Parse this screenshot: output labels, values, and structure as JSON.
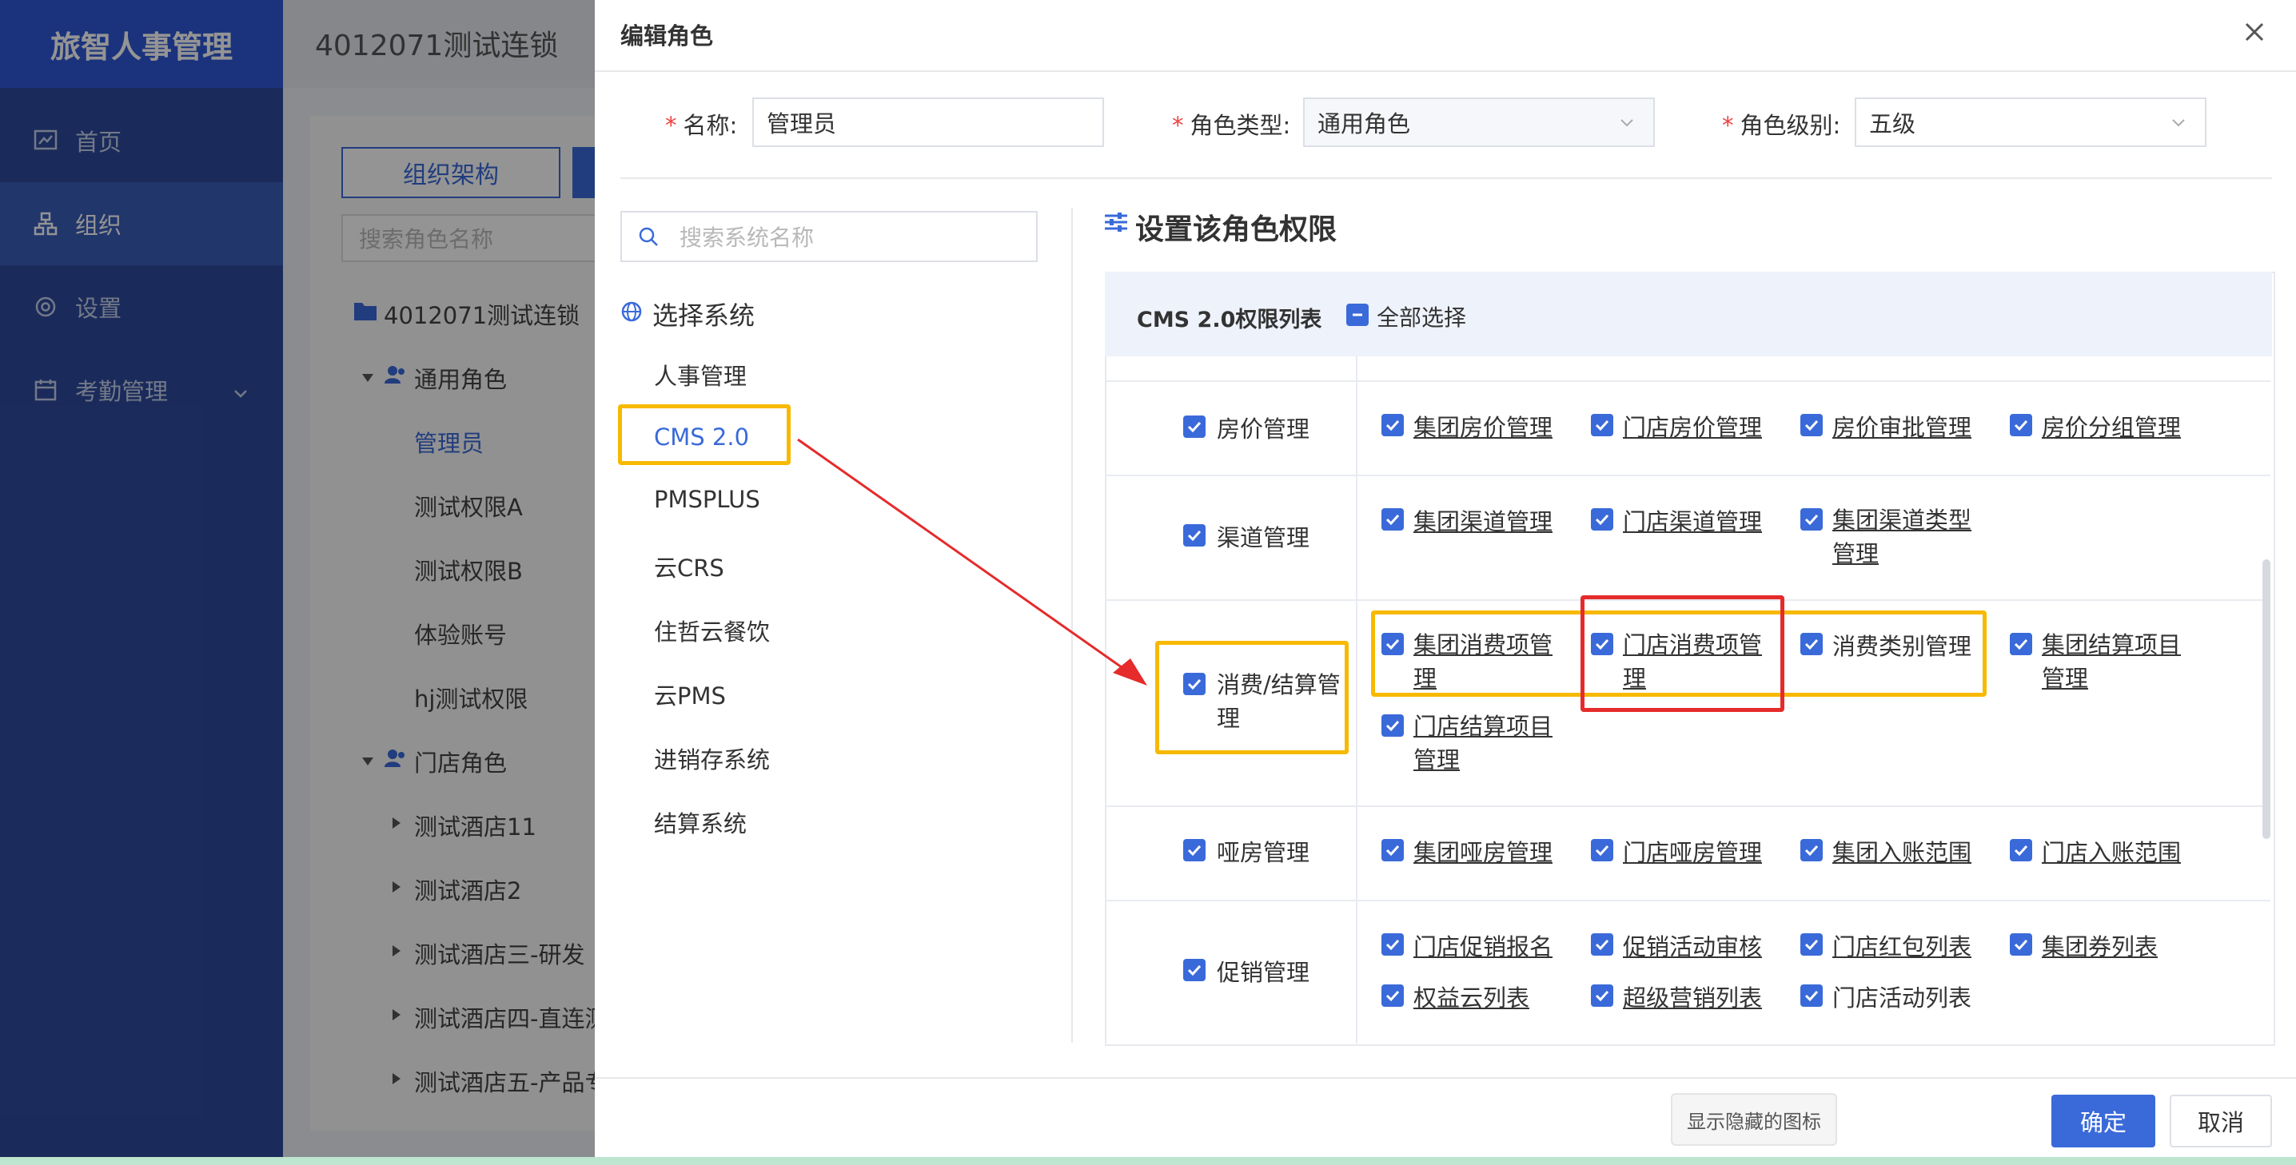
{
  "app": {
    "brand": "旅智人事管理",
    "org_name": "4012071测试连锁"
  },
  "sidebar": {
    "items": [
      {
        "label": "首页"
      },
      {
        "label": "组织"
      },
      {
        "label": "设置"
      },
      {
        "label": "考勤管理"
      }
    ]
  },
  "background": {
    "buttons": [
      "组织架构"
    ],
    "search_placeholder": "搜索角色名称",
    "tree": {
      "root": "4012071测试连锁",
      "general_group": "通用角色",
      "general_roles": [
        "管理员",
        "测试权限A",
        "测试权限B",
        "体验账号",
        "hj测试权限"
      ],
      "store_group": "门店角色",
      "stores": [
        "测试酒店11",
        "测试酒店2",
        "测试酒店三-研发",
        "测试酒店四-直连测",
        "测试酒店五-产品专"
      ]
    }
  },
  "dialog": {
    "title": "编辑角色",
    "form": {
      "name_label": "名称:",
      "name_value": "管理员",
      "type_label": "角色类型:",
      "type_value": "通用角色",
      "level_label": "角色级别:",
      "level_value": "五级"
    },
    "system_search_placeholder": "搜索系统名称",
    "system_heading": "选择系统",
    "systems": [
      "人事管理",
      "CMS 2.0",
      "PMSPLUS",
      "云CRS",
      "住哲云餐饮",
      "云PMS",
      "进销存系统",
      "结算系统"
    ],
    "selected_system": "CMS 2.0",
    "perm_title": "设置该角色权限",
    "table_title": "CMS 2.0权限列表",
    "select_all": "全部选择",
    "rows": [
      {
        "category": "房价管理",
        "items": [
          "集团房价管理",
          "门店房价管理",
          "房价审批管理",
          "房价分组管理"
        ]
      },
      {
        "category": "渠道管理",
        "items": [
          "集团渠道管理",
          "门店渠道管理",
          "集团渠道类型管理"
        ]
      },
      {
        "category": "消费/结算管理",
        "items": [
          "集团消费项管理",
          "门店消费项管理",
          "消费类别管理",
          "集团结算项目管理",
          "门店结算项目管理"
        ]
      },
      {
        "category": "哑房管理",
        "items": [
          "集团哑房管理",
          "门店哑房管理",
          "集团入账范围",
          "门店入账范围"
        ]
      },
      {
        "category": "促销管理",
        "items": [
          "门店促销报名",
          "促销活动审核",
          "门店红包列表",
          "集团券列表",
          "权益云列表",
          "超级营销列表",
          "门店活动列表"
        ]
      }
    ],
    "tooltip": "显示隐藏的图标",
    "ok_label": "确定",
    "cancel_label": "取消"
  },
  "colors": {
    "accent": "#3a6ad9",
    "sidebar": "#2e4a9e",
    "highlight_yellow": "#f7b900",
    "highlight_red": "#e52b2b",
    "required": "#f04040"
  }
}
